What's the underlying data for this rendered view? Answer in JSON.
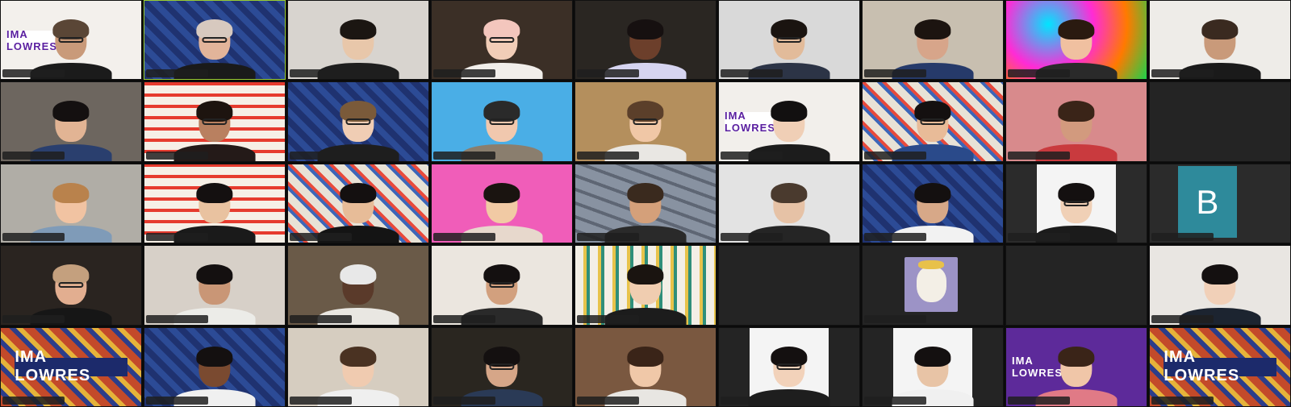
{
  "meeting": {
    "layout": "gallery-view",
    "columns": 9,
    "rows": 5,
    "active_speaker_index": 1
  },
  "tiles": [
    {
      "id": 1,
      "bg": "#f3f0ec",
      "banner": "IMA LOWRES",
      "banner_style": "light",
      "skin": "#c99a7a",
      "hair": "#5a4636",
      "shirt": "#1b1b1b",
      "glasses": true
    },
    {
      "id": 2,
      "bg": "#2a3e7a",
      "pattern": "checker-blue",
      "skin": "#e2b49a",
      "hair": "#d7c9bf",
      "shirt": "#1a1a1a",
      "glasses": true
    },
    {
      "id": 3,
      "bg": "#d8d4cf",
      "skin": "#e8c7aa",
      "hair": "#1b1612",
      "shirt": "#1e1e1e",
      "glasses": false
    },
    {
      "id": 4,
      "bg": "#3b2f26",
      "skin": "#f1cdb7",
      "hair": "#f3c6bd",
      "shirt": "#f1eeea",
      "glasses": true
    },
    {
      "id": 5,
      "bg": "#2a2622",
      "skin": "#6c3f2b",
      "hair": "#161010",
      "shirt": "#d6d4f0",
      "glasses": false
    },
    {
      "id": 6,
      "bg": "#d9d9d9",
      "skin": "#e2bb9a",
      "hair": "#1a1410",
      "shirt": "#2c3446",
      "glasses": true
    },
    {
      "id": 7,
      "bg": "#c8bfb0",
      "skin": "#d7a58a",
      "hair": "#1c1410",
      "shirt": "#263a6a",
      "glasses": false
    },
    {
      "id": 8,
      "bg": "#e12c8c",
      "pattern": "psychedelic",
      "skin": "#f0c0a0",
      "hair": "#2a1a10",
      "shirt": "#2a2a2a",
      "glasses": false
    },
    {
      "id": 9,
      "bg": "#eeece8",
      "skin": "#c99a7a",
      "hair": "#3a2a20",
      "shirt": "#1a1a1a",
      "glasses": false
    },
    {
      "id": 10,
      "bg": "#6d665f",
      "skin": "#e2b494",
      "hair": "#141010",
      "shirt": "#2a3f6e",
      "glasses": false
    },
    {
      "id": 11,
      "bg": "#f3e9e0",
      "pattern": "lowres-red",
      "skin": "#b98060",
      "hair": "#1d140f",
      "shirt": "#241a18",
      "glasses": true
    },
    {
      "id": 12,
      "bg": "#2b3d7b",
      "pattern": "checker-blue",
      "skin": "#f0cdb4",
      "hair": "#7a5a3a",
      "shirt": "#1e1e1e",
      "glasses": true
    },
    {
      "id": 13,
      "bg": "#4aaee6",
      "skin": "#f1c8ae",
      "hair": "#2a2a2a",
      "shirt": "#8a7e6e",
      "glasses": true
    },
    {
      "id": 14,
      "bg": "#b48f5d",
      "skin": "#f0c7a6",
      "hair": "#5b3f2a",
      "shirt": "#e9e7e3",
      "glasses": true
    },
    {
      "id": 15,
      "bg": "#f2efeb",
      "banner": "IMA LOWRES",
      "banner_style": "light",
      "skin": "#f0cfb6",
      "hair": "#121010",
      "shirt": "#1c1c1c",
      "glasses": false
    },
    {
      "id": 16,
      "bg": "#e9e3d6",
      "pattern": "mosaic",
      "skin": "#e8bb98",
      "hair": "#141010",
      "shirt": "#2a4a8a",
      "glasses": true
    },
    {
      "id": 17,
      "bg": "#d88a8c",
      "skin": "#d29a7e",
      "hair": "#3a2418",
      "shirt": "#c93a3e",
      "glasses": false
    },
    {
      "id": 18,
      "empty": true
    },
    {
      "id": 19,
      "bg": "#b0ada6",
      "skin": "#f1c3a2",
      "hair": "#b9824c",
      "shirt": "#7f9bb8",
      "glasses": false
    },
    {
      "id": 20,
      "bg": "#f3e9e0",
      "pattern": "lowres-red",
      "skin": "#e9c2a0",
      "hair": "#141010",
      "shirt": "#1a1a1a",
      "glasses": false
    },
    {
      "id": 21,
      "bg": "#f1ede4",
      "pattern": "mosaic",
      "skin": "#e7bc98",
      "hair": "#141010",
      "shirt": "#141414",
      "glasses": false
    },
    {
      "id": 22,
      "bg": "#f05db9",
      "skin": "#f1caa4",
      "hair": "#1a1410",
      "shirt": "#e7d8cc",
      "glasses": false
    },
    {
      "id": 23,
      "bg": "#7a8696",
      "pattern": "shatter",
      "skin": "#d4a07a",
      "hair": "#3a2a1e",
      "shirt": "#2a2a2a",
      "glasses": false
    },
    {
      "id": 24,
      "bg": "#e3e3e3",
      "skin": "#e6c2a6",
      "hair": "#4a3a2e",
      "shirt": "#252525",
      "glasses": false
    },
    {
      "id": 25,
      "bg": "#2b3d7b",
      "pattern": "checker-blue",
      "skin": "#d7a888",
      "hair": "#141010",
      "shirt": "#f2f2f2",
      "glasses": false
    },
    {
      "id": 26,
      "card": "photo",
      "bg": "#2b2b2b",
      "skin": "#f0d0b6",
      "hair": "#141010",
      "shirt": "#1b1b1b",
      "glasses": true
    },
    {
      "id": 27,
      "letter": "B",
      "bg": "#2b2b2b",
      "letter_bg": "#2e8a9b"
    },
    {
      "id": 28,
      "bg": "#2a2420",
      "skin": "#e2ae90",
      "hair": "#c4a07e",
      "shirt": "#161616",
      "glasses": true
    },
    {
      "id": 29,
      "bg": "#d7d0c8",
      "skin": "#c99676",
      "hair": "#141010",
      "shirt": "#ecece8",
      "glasses": false
    },
    {
      "id": 30,
      "bg": "#6a5a48",
      "skin": "#5a3a2a",
      "hair": "#e8e8e8",
      "shirt": "#e9e7e2",
      "glasses": false
    },
    {
      "id": 31,
      "bg": "#ebe6df",
      "skin": "#d2a07e",
      "hair": "#141010",
      "shirt": "#2a2a2a",
      "glasses": true
    },
    {
      "id": 32,
      "bg": "#f1ede4",
      "pattern": "lowres-yellow",
      "skin": "#f0cdb0",
      "hair": "#1a1410",
      "shirt": "#1c1c1c",
      "glasses": false
    },
    {
      "id": 33,
      "empty": true
    },
    {
      "id": 34,
      "pet": true,
      "bg": "#242424"
    },
    {
      "id": 35,
      "empty": true
    },
    {
      "id": 36,
      "bg": "#e9e6e2",
      "skin": "#f1d0b8",
      "hair": "#141010",
      "shirt": "#1c2430",
      "glasses": false
    },
    {
      "id": 37,
      "bg": "#c34a2a",
      "banner": "IMA LOWRES",
      "banner_style": "dark",
      "pattern": "mosaic-warm"
    },
    {
      "id": 38,
      "bg": "#2b3d7b",
      "pattern": "checker-blue",
      "skin": "#7a4a30",
      "hair": "#141010",
      "shirt": "#f0f0f0",
      "glasses": false
    },
    {
      "id": 39,
      "bg": "#d6cdc0",
      "skin": "#f0cbb0",
      "hair": "#4a3222",
      "shirt": "#efefef",
      "glasses": false
    },
    {
      "id": 40,
      "bg": "#2a2620",
      "skin": "#d6a688",
      "hair": "#141010",
      "shirt": "#2a3a56",
      "glasses": true
    },
    {
      "id": 41,
      "bg": "#7a5840",
      "skin": "#f0c8a8",
      "hair": "#3a2418",
      "shirt": "#e8e6e2",
      "glasses": false
    },
    {
      "id": 42,
      "card": "photo",
      "bg": "#242424",
      "skin": "#f2d2ba",
      "hair": "#141010",
      "shirt": "#1e1e1e",
      "glasses": true
    },
    {
      "id": 43,
      "card": "photo",
      "bg": "#242424",
      "skin": "#e8c4a6",
      "hair": "#141010",
      "shirt": "#f0f0f0",
      "glasses": false
    },
    {
      "id": 44,
      "bg": "#5d2a9a",
      "banner": "IMA LOWRES",
      "banner_style": "purple",
      "skin": "#f0c6a8",
      "hair": "#3a2418",
      "shirt": "#e07a86",
      "glasses": false
    },
    {
      "id": 45,
      "bg": "#c34a2a",
      "banner": "IMA LOWRES",
      "banner_style": "dark",
      "pattern": "mosaic-warm"
    }
  ]
}
